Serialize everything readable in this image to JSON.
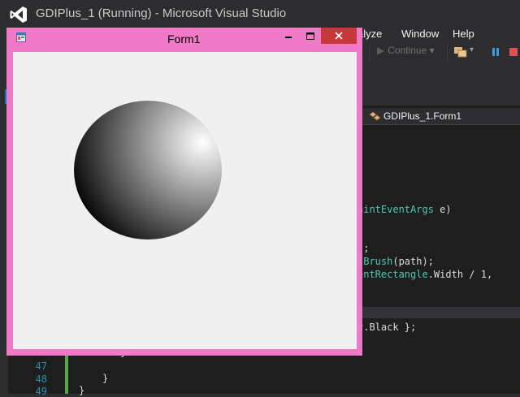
{
  "vs": {
    "title": "GDIPlus_1 (Running) - Microsoft Visual Studio",
    "menu": [
      "alyze",
      "Window",
      "Help"
    ],
    "toolbar": {
      "continue_label": "Continue",
      "dropdown": "▾"
    },
    "nav": {
      "class_label": "GDIPlus_1.Form1"
    },
    "code_lines": [
      {
        "pre": "",
        "teal": "aintEventArgs",
        "post": " e)"
      },
      {
        "pre": ";",
        "teal": "",
        "post": ""
      },
      {
        "pre": ");",
        "teal": "",
        "post": ""
      },
      {
        "pre": "",
        "teal": "tBrush",
        "post": "(path);"
      },
      {
        "pre": "",
        "teal": "entRectangle",
        "post": ".Width / 1,"
      },
      {
        "pre": ";",
        "teal": "",
        "post": ""
      }
    ],
    "code_after_split": {
      "pre": "",
      "teal": "r",
      "post": ".Black };"
    },
    "line_numbers": [
      "47",
      "48",
      "49"
    ],
    "brace_lines": [
      "}",
      "}",
      "}"
    ]
  },
  "form": {
    "title": "Form1",
    "min_glyph": "—",
    "max_glyph": "□",
    "close_glyph": "✕"
  },
  "sphere": {
    "highlight_color": "#ffffff",
    "shadow_color": "#000000"
  },
  "colors": {
    "form_border": "#f07ac7",
    "close_button": "#c7383b",
    "vs_background": "#2d2d30",
    "editor_background": "#1e1e1e",
    "type_color": "#4ec9b0"
  }
}
